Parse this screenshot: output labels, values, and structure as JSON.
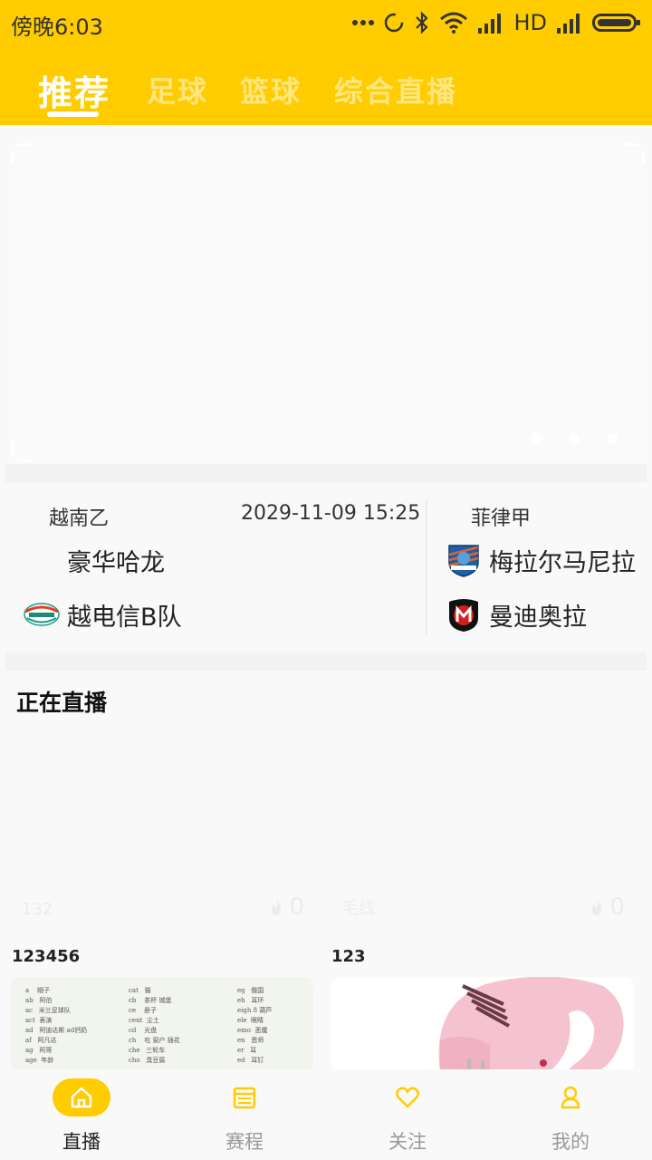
{
  "status_bar": {
    "time": "傍晚6:03",
    "network_label": "HD"
  },
  "tabs": [
    {
      "label": "推荐",
      "active": true
    },
    {
      "label": "足球",
      "active": false
    },
    {
      "label": "篮球",
      "active": false
    },
    {
      "label": "综合直播",
      "active": false
    }
  ],
  "match": {
    "left": {
      "league": "越南乙",
      "time": "2029-11-09 15:25",
      "home": "豪华哈龙",
      "away": "越电信B队"
    },
    "right": {
      "league": "菲律甲",
      "home": "梅拉尔马尼拉",
      "away": "曼迪奥拉"
    }
  },
  "live": {
    "section_title": "正在直播",
    "cards": [
      {
        "anchor": "132",
        "heat": "0",
        "title": "123456",
        "thumb": "vocab-sheet"
      },
      {
        "anchor": "毛线",
        "heat": "0",
        "title": "123",
        "thumb": "pink-mixer"
      }
    ]
  },
  "bottom_nav": [
    {
      "label": "直播",
      "icon": "home-icon",
      "active": true
    },
    {
      "label": "赛程",
      "icon": "calendar-icon",
      "active": false
    },
    {
      "label": "关注",
      "icon": "heart-icon",
      "active": false
    },
    {
      "label": "我的",
      "icon": "user-icon",
      "active": false
    }
  ],
  "colors": {
    "accent": "#ffcc00",
    "tab_inactive": "#ffe680"
  }
}
